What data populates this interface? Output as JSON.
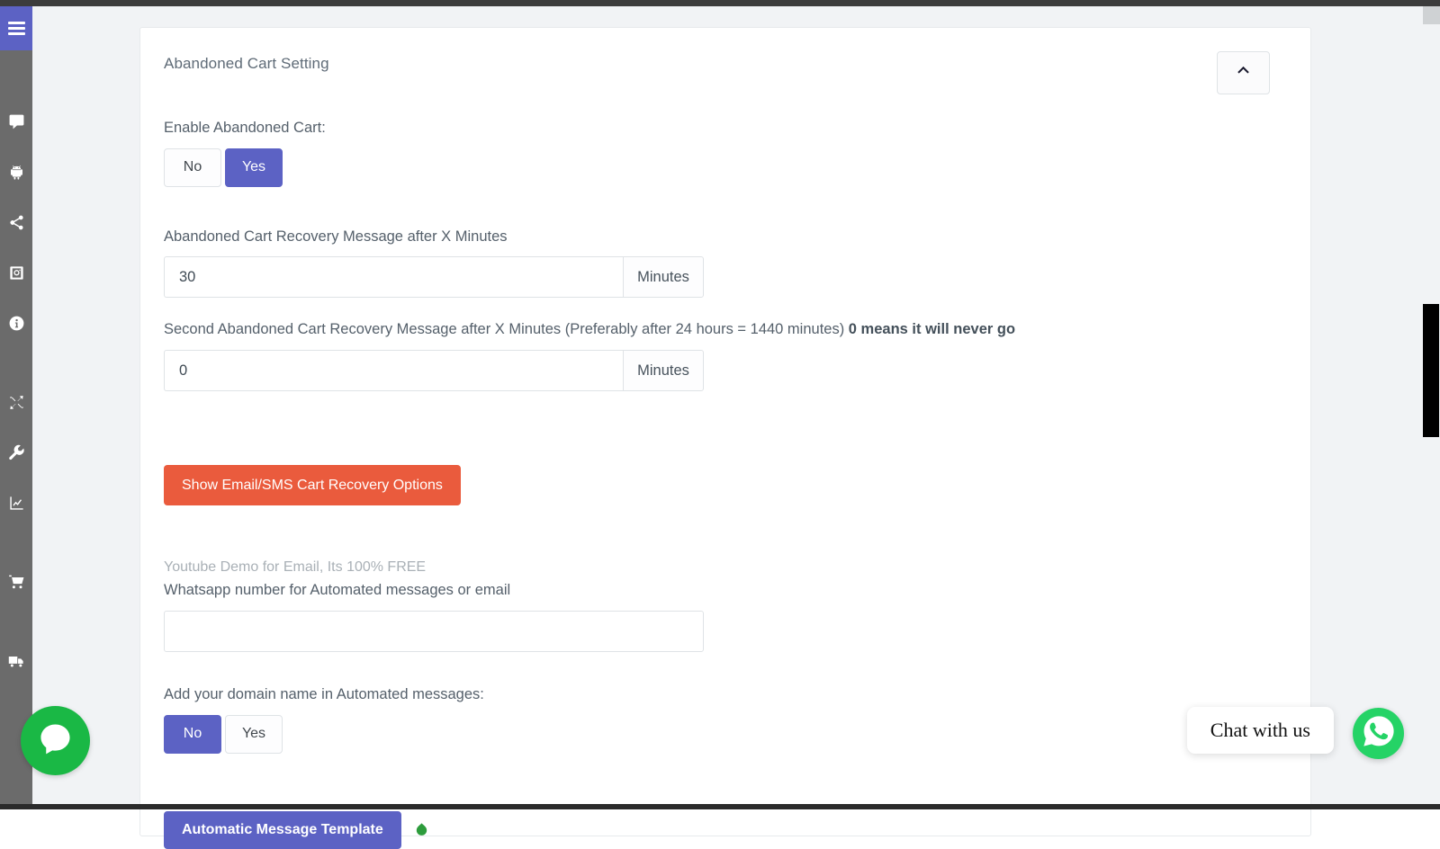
{
  "sidebar": {
    "toggle_label": "menu",
    "items": [
      {
        "icon": "comment-icon",
        "name": "sidebar-item-comment"
      },
      {
        "icon": "android-icon",
        "name": "sidebar-item-android"
      },
      {
        "icon": "share-icon",
        "name": "sidebar-item-share"
      },
      {
        "icon": "instagram-icon",
        "name": "sidebar-item-instagram"
      },
      {
        "icon": "info-icon",
        "name": "sidebar-item-info"
      },
      {
        "icon": "compress-arrows-icon",
        "name": "sidebar-item-compress"
      },
      {
        "icon": "wrench-icon",
        "name": "sidebar-item-wrench"
      },
      {
        "icon": "chart-line-icon",
        "name": "sidebar-item-analytics"
      },
      {
        "icon": "shopping-cart-icon",
        "name": "sidebar-item-cart"
      },
      {
        "icon": "truck-icon",
        "name": "sidebar-item-shipping"
      }
    ]
  },
  "card": {
    "title": "Abandoned Cart Setting",
    "collapse_icon": "chevron-up-icon"
  },
  "form": {
    "enable_cart": {
      "label": "Enable Abandoned Cart:",
      "options": [
        "No",
        "Yes"
      ],
      "selected": "Yes"
    },
    "recovery_minutes": {
      "label": "Abandoned Cart Recovery Message after X Minutes",
      "value": "30",
      "addon": "Minutes"
    },
    "second_recovery_minutes": {
      "label_part1": "Second Abandoned Cart Recovery Message after X Minutes (Preferably after 24 hours = 1440 minutes) ",
      "label_bold": "0 means it will never go",
      "value": "0",
      "addon": "Minutes"
    },
    "show_recovery_options_button": "Show Email/SMS Cart Recovery Options",
    "youtube_demo_link": "Youtube Demo for Email, Its 100% FREE",
    "whatsapp_number": {
      "label": "Whatsapp number for Automated messages or email",
      "value": "",
      "placeholder": ""
    },
    "add_domain": {
      "label": "Add your domain name in Automated messages:",
      "options": [
        "No",
        "Yes"
      ],
      "selected": "No"
    },
    "automatic_message_template_button": "Automatic Message Template"
  },
  "widgets": {
    "chat_bubble": "chat-bubble-icon",
    "chat_with_us_label": "Chat with us",
    "whatsapp_icon": "whatsapp-icon"
  },
  "colors": {
    "primary_purple": "#5c62c4",
    "orange": "#ea5b3d",
    "sidebar_gray": "#6b6b6b",
    "page_bg": "#f1f3f5",
    "whatsapp_green": "#25d366",
    "chat_green": "#1ab845"
  }
}
